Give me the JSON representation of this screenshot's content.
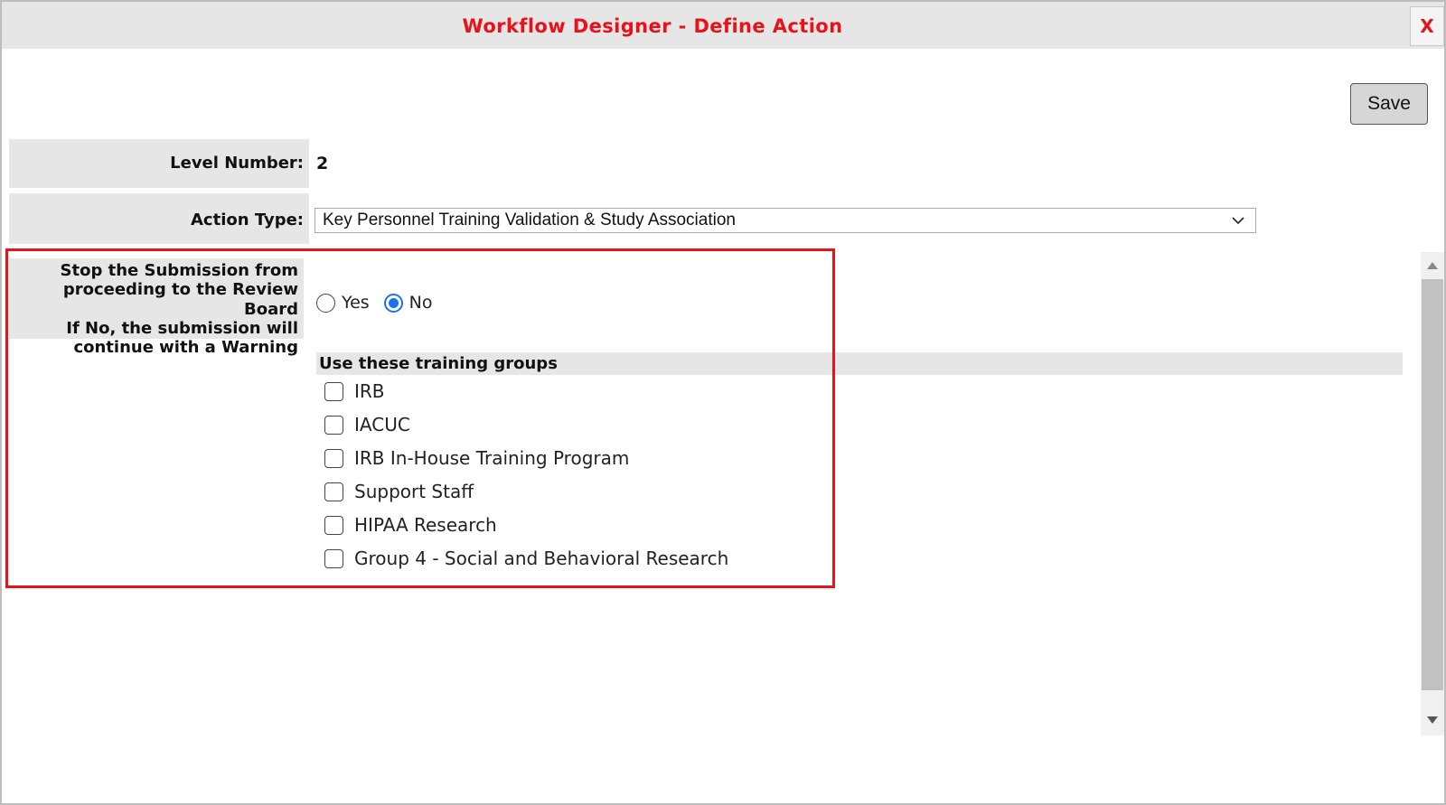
{
  "dialog": {
    "title": "Workflow Designer - Define Action",
    "close_label": "X",
    "save_label": "Save"
  },
  "form": {
    "level_label": "Level Number:",
    "level_value": "2",
    "action_type_label": "Action Type:",
    "action_type_value": "Key Personnel Training Validation & Study Association",
    "stop_label_lines": [
      "Stop the Submission from",
      "proceeding to the Review Board",
      "If No, the submission will",
      "continue with a Warning"
    ],
    "stop_options": [
      {
        "label": "Yes",
        "selected": false
      },
      {
        "label": "No",
        "selected": true
      }
    ],
    "training_groups_header": "Use these training groups",
    "training_groups": [
      {
        "label": "IRB",
        "checked": false
      },
      {
        "label": "IACUC",
        "checked": false
      },
      {
        "label": "IRB In-House Training Program",
        "checked": false
      },
      {
        "label": "Support Staff",
        "checked": false
      },
      {
        "label": "HIPAA Research",
        "checked": false
      },
      {
        "label": "Group 4 - Social and Behavioral Research",
        "checked": false
      }
    ]
  },
  "colors": {
    "title_red": "#e8121b",
    "highlight_red": "#e8121b",
    "radio_blue": "#1a73e8",
    "label_bg": "#e6e6e6"
  },
  "icons": {
    "dropdown": "chevron-down-icon",
    "scroll_up": "arrow-up-icon",
    "scroll_down": "arrow-down-icon"
  }
}
